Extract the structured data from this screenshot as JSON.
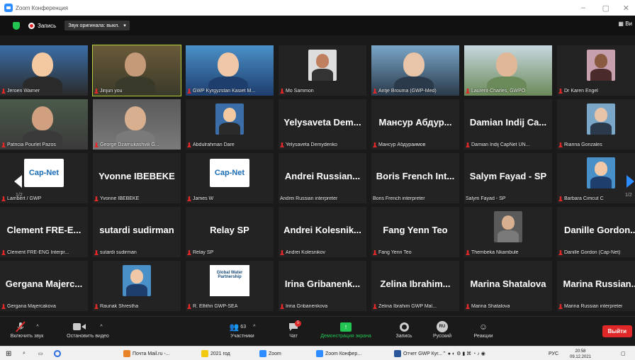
{
  "window": {
    "title": "Zoom Конференция"
  },
  "topbar": {
    "record_label": "Запись",
    "original_sound": "Звук оригинала: выкл.",
    "view_label": "Ви"
  },
  "tiles": [
    {
      "name": "Jeroen Warner",
      "big": "",
      "kind": "video"
    },
    {
      "name": "Jinjun you",
      "big": "",
      "kind": "video",
      "active": true
    },
    {
      "name": "GWP Kyrgyzstan Kasiet M...",
      "big": "",
      "kind": "video"
    },
    {
      "name": "Mo Sammon",
      "big": "",
      "kind": "photo"
    },
    {
      "name": "Antje Brouma (GWP-Med)",
      "big": "",
      "kind": "video"
    },
    {
      "name": "Laurent-Charles, GWPO",
      "big": "",
      "kind": "video"
    },
    {
      "name": "Dr Karen Engel",
      "big": "",
      "kind": "photo"
    },
    {
      "name": "Patricia Pourlet Pazos",
      "big": "",
      "kind": "video"
    },
    {
      "name": "George Dzamukashvili G...",
      "big": "",
      "kind": "video"
    },
    {
      "name": "Abdulrahman Dare",
      "big": "",
      "kind": "photo"
    },
    {
      "name": "Yelysaveta Demydenko",
      "big": "Yelysaveta Dem...",
      "kind": "text"
    },
    {
      "name": "Мансур Абдураимов",
      "big": "Мансур Абдур...",
      "kind": "text"
    },
    {
      "name": "Damian Indij CapNet UN...",
      "big": "Damian Indij Ca...",
      "kind": "text"
    },
    {
      "name": "Rianna Gonzales",
      "big": "",
      "kind": "photo"
    },
    {
      "name": "Lambert / GWP",
      "big": "",
      "kind": "capnet"
    },
    {
      "name": "Yvonne IBEBEKE",
      "big": "Yvonne IBEBEKE",
      "kind": "text"
    },
    {
      "name": "James W",
      "big": "",
      "kind": "capnet"
    },
    {
      "name": "Andrei Russian interpreter",
      "big": "Andrei Russian...",
      "kind": "text",
      "nomic": true
    },
    {
      "name": "Boris French interpreter",
      "big": "Boris French Int...",
      "kind": "text",
      "nomic": true
    },
    {
      "name": "Salym Fayad - SP",
      "big": "Salym Fayad - SP",
      "kind": "text",
      "nomic": true
    },
    {
      "name": "Barbara Cimcut C",
      "big": "",
      "kind": "photo"
    },
    {
      "name": "Clement FRE-ENG Interpr...",
      "big": "Clement FRE-E...",
      "kind": "text"
    },
    {
      "name": "sutardi sudirman",
      "big": "sutardi sudirman",
      "kind": "text"
    },
    {
      "name": "Relay SP",
      "big": "Relay SP",
      "kind": "text"
    },
    {
      "name": "Andrei Kolesnikov",
      "big": "Andrei Kolesnik...",
      "kind": "text"
    },
    {
      "name": "Fang Yenn Teo",
      "big": "Fang Yenn Teo",
      "kind": "text"
    },
    {
      "name": "Thembeka Nkambule",
      "big": "",
      "kind": "photo"
    },
    {
      "name": "Danille Gordon (Cap-Net)",
      "big": "Danille Gordon...",
      "kind": "text"
    },
    {
      "name": "Gergana Majercakova",
      "big": "Gergana Majerc...",
      "kind": "text"
    },
    {
      "name": "Raunak Shrestha",
      "big": "",
      "kind": "photo"
    },
    {
      "name": "R. Elfithri GWP-SEA",
      "big": "",
      "kind": "gwp"
    },
    {
      "name": "Irina Gribanenkova",
      "big": "Irina Gribanenk...",
      "kind": "text"
    },
    {
      "name": "Zelina Ibrahim GWP Mal...",
      "big": "Zelina Ibrahim...",
      "kind": "text"
    },
    {
      "name": "Marina Shatalova",
      "big": "Marina Shatalova",
      "kind": "text"
    },
    {
      "name": "Marina Russian interpreter",
      "big": "Marina Russian...",
      "kind": "text"
    }
  ],
  "tile_logos": {
    "capnet": "Cap-Net",
    "gwp": "Global Water Partnership"
  },
  "pagination": {
    "left": "1/2",
    "right": "1/2"
  },
  "toolbar": {
    "unmute": "Включить звук",
    "stop_video": "Остановить видео",
    "participants": "Участники",
    "participants_count": "63",
    "chat": "Чат",
    "chat_badge": "5",
    "share": "Демонстрация экрана",
    "record": "Запись",
    "language": "Русский",
    "language_code": "RU",
    "reactions": "Реакции",
    "leave": "Выйти"
  },
  "taskbar": {
    "items": [
      "Почта Mail.ru -...",
      "2021 год",
      "Zoom",
      "Zoom Конфер...",
      "Отчет GWP Кyr..."
    ],
    "lang": "РУС",
    "time": "20:58",
    "date": "09.12.2021"
  }
}
